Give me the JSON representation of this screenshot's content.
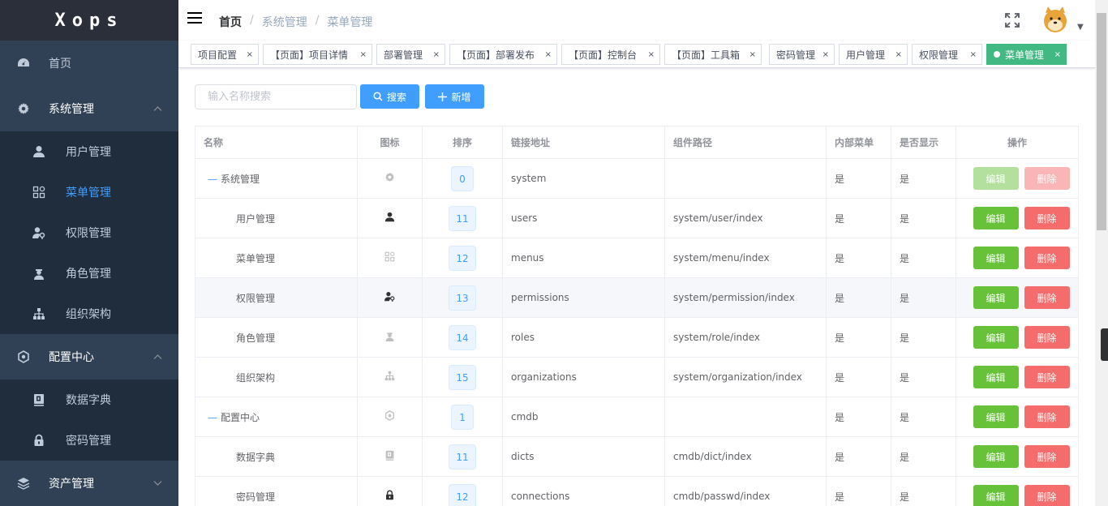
{
  "app": {
    "logo": "Xops"
  },
  "sidebar": {
    "home": {
      "label": "首页",
      "icon": "dashboard-icon"
    },
    "groups": [
      {
        "label": "系统管理",
        "icon": "gear-icon",
        "expanded": true,
        "items": [
          {
            "label": "用户管理",
            "icon": "user-icon"
          },
          {
            "label": "菜单管理",
            "icon": "menu-grid-icon",
            "active": true
          },
          {
            "label": "权限管理",
            "icon": "permission-icon"
          },
          {
            "label": "角色管理",
            "icon": "role-icon"
          },
          {
            "label": "组织架构",
            "icon": "org-tree-icon"
          }
        ]
      },
      {
        "label": "配置中心",
        "icon": "config-icon",
        "expanded": true,
        "items": [
          {
            "label": "数据字典",
            "icon": "dict-icon"
          },
          {
            "label": "密码管理",
            "icon": "lock-icon"
          }
        ]
      },
      {
        "label": "资产管理",
        "icon": "layers-icon",
        "expanded": false
      }
    ]
  },
  "navbar": {
    "breadcrumb": [
      "首页",
      "系统管理",
      "菜单管理"
    ]
  },
  "tags": [
    {
      "label": "项目配置"
    },
    {
      "label": "【页面】项目详情"
    },
    {
      "label": "部署管理"
    },
    {
      "label": "【页面】部署发布"
    },
    {
      "label": "【页面】控制台"
    },
    {
      "label": "【页面】工具箱"
    },
    {
      "label": "密码管理"
    },
    {
      "label": "用户管理"
    },
    {
      "label": "权限管理"
    },
    {
      "label": "菜单管理",
      "active": true
    }
  ],
  "toolbar": {
    "search_placeholder": "输入名称搜索",
    "search_label": "搜索",
    "add_label": "新增"
  },
  "table": {
    "columns": [
      "名称",
      "图标",
      "排序",
      "链接地址",
      "组件路径",
      "内部菜单",
      "是否显示",
      "操作"
    ],
    "edit_label": "编辑",
    "delete_label": "删除",
    "toggle_glyph": "—",
    "rows": [
      {
        "name": "系统管理",
        "level": 1,
        "icon": "gear-icon",
        "sort": "0",
        "link": "system",
        "component": "",
        "internal": "是",
        "visible": "是",
        "disabled": true
      },
      {
        "name": "用户管理",
        "level": 2,
        "icon": "user-icon",
        "sort": "11",
        "link": "users",
        "component": "system/user/index",
        "internal": "是",
        "visible": "是"
      },
      {
        "name": "菜单管理",
        "level": 2,
        "icon": "menu-grid-icon",
        "sort": "12",
        "link": "menus",
        "component": "system/menu/index",
        "internal": "是",
        "visible": "是"
      },
      {
        "name": "权限管理",
        "level": 2,
        "icon": "permission-icon",
        "sort": "13",
        "link": "permissions",
        "component": "system/permission/index",
        "internal": "是",
        "visible": "是",
        "highlight": true
      },
      {
        "name": "角色管理",
        "level": 2,
        "icon": "role-icon",
        "sort": "14",
        "link": "roles",
        "component": "system/role/index",
        "internal": "是",
        "visible": "是"
      },
      {
        "name": "组织架构",
        "level": 2,
        "icon": "org-tree-icon",
        "sort": "15",
        "link": "organizations",
        "component": "system/organization/index",
        "internal": "是",
        "visible": "是"
      },
      {
        "name": "配置中心",
        "level": 1,
        "icon": "config-icon",
        "sort": "1",
        "link": "cmdb",
        "component": "",
        "internal": "是",
        "visible": "是"
      },
      {
        "name": "数据字典",
        "level": 2,
        "icon": "dict-icon",
        "sort": "11",
        "link": "dicts",
        "component": "cmdb/dict/index",
        "internal": "是",
        "visible": "是"
      },
      {
        "name": "密码管理",
        "level": 2,
        "icon": "lock-icon",
        "sort": "12",
        "link": "connections",
        "component": "cmdb/passwd/index",
        "internal": "是",
        "visible": "是"
      }
    ]
  }
}
